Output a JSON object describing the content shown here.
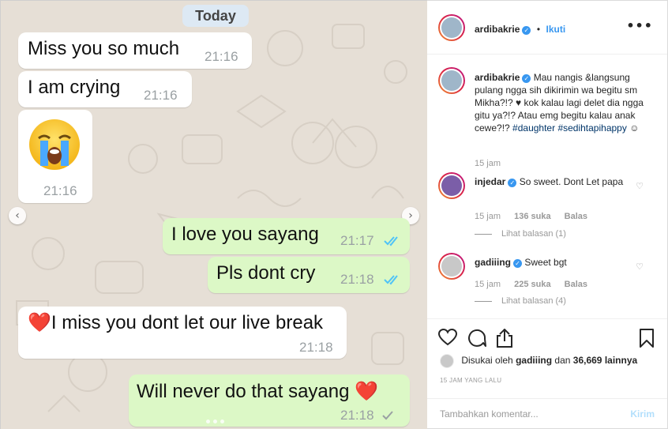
{
  "chat": {
    "date_label": "Today",
    "messages": [
      {
        "text": "Miss you so much",
        "time": "21:16"
      },
      {
        "text": "I am crying",
        "time": "21:16"
      },
      {
        "emoji": "😭",
        "time": "21:16"
      },
      {
        "text": "I love you sayang",
        "time": "21:17"
      },
      {
        "text": "Pls dont cry",
        "time": "21:18"
      },
      {
        "text": "❤️I miss you dont let our live break",
        "time": "21:18"
      },
      {
        "text": "Will never do that sayang ❤️",
        "time": "21:18"
      }
    ],
    "prev_arrow": "‹",
    "next_arrow": "›"
  },
  "post": {
    "header": {
      "username": "ardibakrie",
      "verified_mark": "✓",
      "separator": "•",
      "follow_label": "Ikuti",
      "more_label": "•••"
    },
    "caption": {
      "username": "ardibakrie",
      "text": "Mau nangis &langsung pulang ngga sih dikirimin wa begitu sm Mikha?!? ♥ kok kalau lagi delet dia ngga gitu ya?!? Atau emg begitu kalau anak cewe?!?",
      "hashtag1": "#daughter",
      "hashtag2": "#sedihtapihappy",
      "end_emoji": "☺",
      "time": "15 jam"
    },
    "comments": [
      {
        "username": "injedar",
        "text": "So sweet. Dont Let papa",
        "time": "15 jam",
        "likes": "136 suka",
        "reply_label": "Balas",
        "view_replies": "Lihat balasan (1)"
      },
      {
        "username": "gadiiing",
        "text": "Sweet bgt",
        "time": "15 jam",
        "likes": "225 suka",
        "reply_label": "Balas",
        "view_replies": "Lihat balasan (4)"
      }
    ],
    "likes_line": {
      "prefix": "Disukai oleh",
      "user": "gadiiing",
      "middle": "dan",
      "count": "36,669 lainnya"
    },
    "time_ago": "15 JAM YANG LALU",
    "comment_placeholder": "Tambahkan komentar...",
    "send_label": "Kirim",
    "colors": {
      "link_blue": "#3897f0",
      "hashtag": "#003569",
      "wa_outgoing": "#dcf8c6",
      "read_ticks": "#4fc3f7"
    },
    "icons": [
      "heart-icon",
      "comment-icon",
      "share-icon",
      "bookmark-icon"
    ]
  }
}
